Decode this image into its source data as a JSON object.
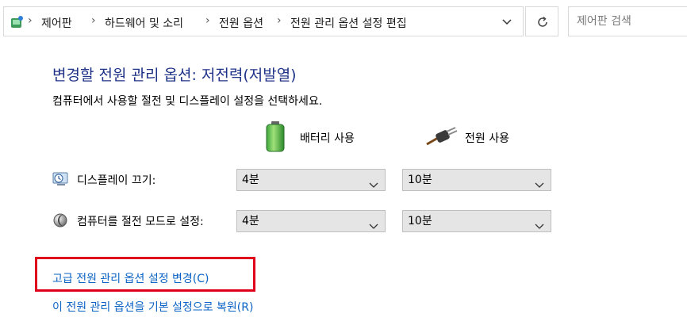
{
  "address_bar": {
    "breadcrumbs": [
      "제어판",
      "하드웨어 및 소리",
      "전원 옵션",
      "전원 관리 옵션 설정 편집"
    ]
  },
  "search": {
    "placeholder": "제어판 검색"
  },
  "page": {
    "title": "변경할 전원 관리 옵션: 저전력(저발열)",
    "subtitle": "컴퓨터에서 사용할 절전 및 디스플레이 설정을 선택하세요."
  },
  "columns": {
    "battery": "배터리 사용",
    "plugged_in": "전원 사용"
  },
  "settings": [
    {
      "label": "디스플레이 끄기:",
      "battery_value": "4분",
      "plugged_value": "10분"
    },
    {
      "label": "컴퓨터를 절전 모드로 설정:",
      "battery_value": "4분",
      "plugged_value": "10분"
    }
  ],
  "links": {
    "advanced": "고급 전원 관리 옵션 설정 변경(C)",
    "restore": "이 전원 관리 옵션을 기본 설정으로 복원(R)"
  },
  "colors": {
    "title": "#1e3287",
    "link": "#0b63c5",
    "highlight_box": "#e0001b",
    "dropdown_bg": "#e5e5e5"
  },
  "icons": {
    "address_bar": "control-panel-icon",
    "refresh": "refresh-icon",
    "battery": "battery-icon",
    "plugged_in": "power-plug-icon",
    "display_off": "display-clock-icon",
    "sleep": "moon-icon"
  }
}
